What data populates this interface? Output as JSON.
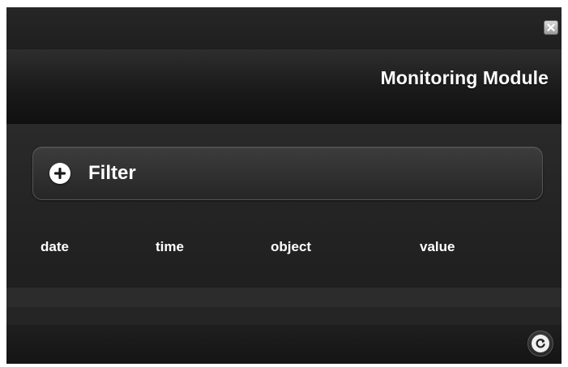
{
  "window": {
    "title": "Monitoring Module",
    "close_icon": "close-icon",
    "refresh_icon": "refresh-icon"
  },
  "filter": {
    "label": "Filter",
    "icon": "plus-icon"
  },
  "table": {
    "columns": [
      "date",
      "time",
      "object",
      "value"
    ]
  },
  "colors": {
    "background": "#1e1e1e",
    "text": "#ffffff"
  }
}
